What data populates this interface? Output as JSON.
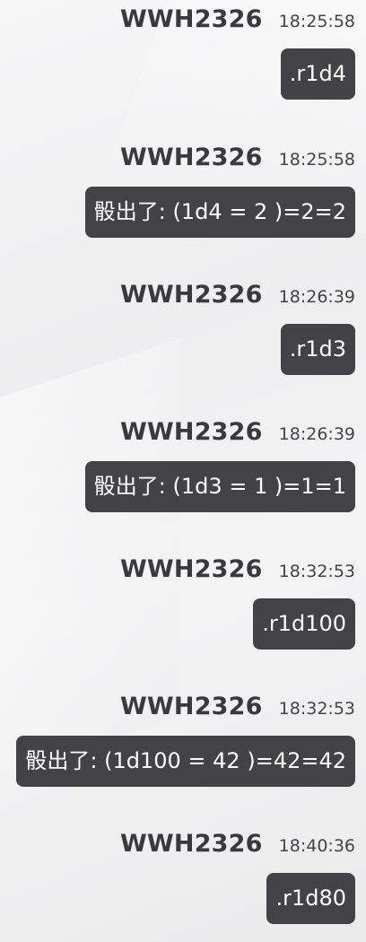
{
  "messages": [
    {
      "sender": "WWH2326",
      "time": "18:25:58",
      "text": ".r1d4"
    },
    {
      "sender": "WWH2326",
      "time": "18:25:58",
      "text": "骰出了: (1d4 = 2 )=2=2"
    },
    {
      "sender": "WWH2326",
      "time": "18:26:39",
      "text": ".r1d3"
    },
    {
      "sender": "WWH2326",
      "time": "18:26:39",
      "text": "骰出了: (1d3 = 1 )=1=1"
    },
    {
      "sender": "WWH2326",
      "time": "18:32:53",
      "text": ".r1d100"
    },
    {
      "sender": "WWH2326",
      "time": "18:32:53",
      "text": "骰出了: (1d100 = 42 )=42=42"
    },
    {
      "sender": "WWH2326",
      "time": "18:40:36",
      "text": ".r1d80"
    }
  ]
}
